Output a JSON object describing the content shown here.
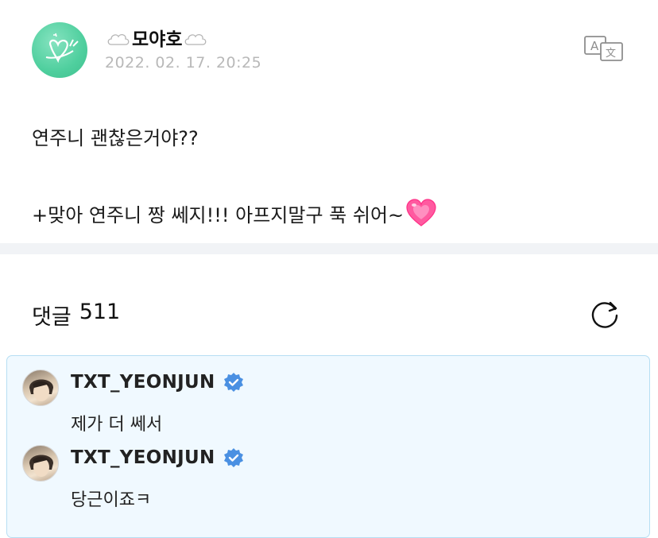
{
  "post": {
    "author": "모야호",
    "date": "2022. 02. 17. 20:25",
    "line1": "연주니 괜찮은거야??",
    "line2": "+맞아 연주니 짱 쎄지!!! 아프지말구 푹 쉬어~",
    "translate_icon": "translate-icon",
    "heart_icon": "growing-heart-emoji"
  },
  "comments": {
    "label": "댓글",
    "count": "511",
    "refresh_icon": "refresh-icon",
    "items": [
      {
        "name": "TXT_YEONJUN",
        "text": "제가 더 쎄서",
        "verified": true
      },
      {
        "name": "TXT_YEONJUN",
        "text": "당근이죠ㅋ",
        "verified": true
      }
    ]
  },
  "colors": {
    "accent_blue": "#4a90e2",
    "reply_bg": "#f0f9ff",
    "avatar_green": "#4fcf9e",
    "heart_pink": "#ff3d8b"
  }
}
